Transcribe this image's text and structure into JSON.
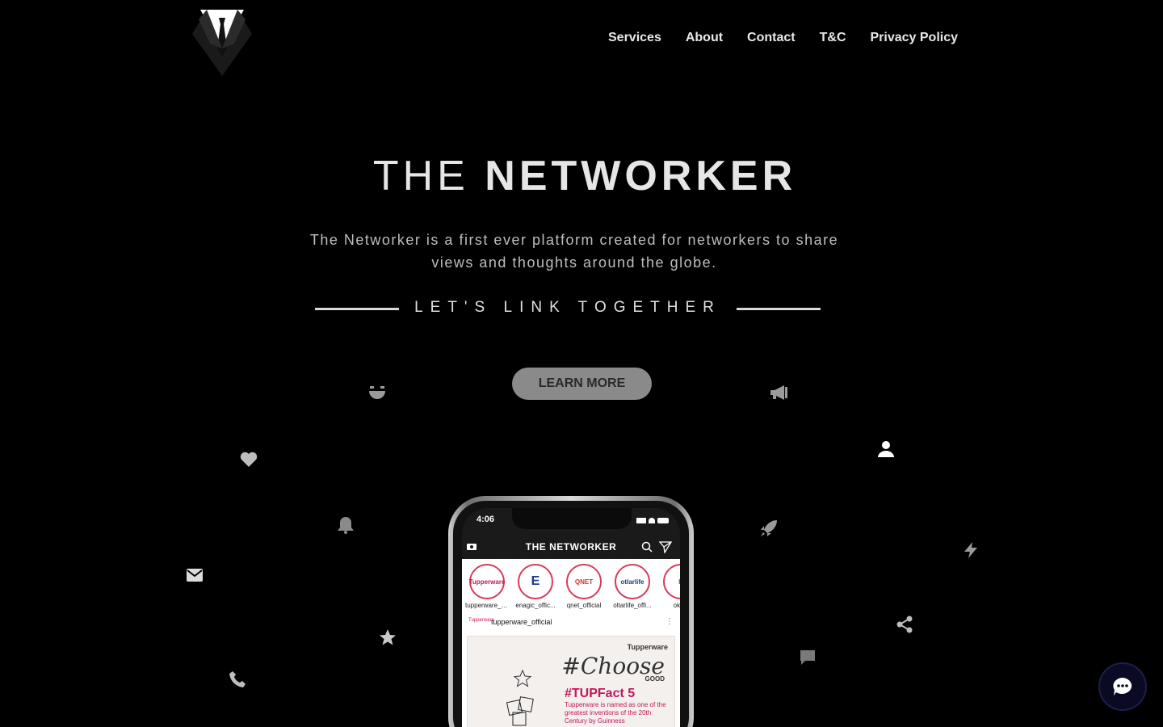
{
  "nav": {
    "items": [
      {
        "label": "Services"
      },
      {
        "label": "About"
      },
      {
        "label": "Contact"
      },
      {
        "label": "T&C"
      },
      {
        "label": "Privacy Policy"
      }
    ]
  },
  "hero": {
    "title_light": "THE ",
    "title_bold": "NETWORKER",
    "description": "The Networker is a first ever platform created for networkers to share views and thoughts around the globe.",
    "tagline": "LET'S LINK TOGETHER",
    "cta_label": "LEARN MORE"
  },
  "phone": {
    "time": "4:06",
    "app_title": "THE NETWORKER",
    "stories": [
      {
        "logo": "Tupperware",
        "name": "tupperware_offi..."
      },
      {
        "logo": "E",
        "name": "enagic_offic..."
      },
      {
        "logo": "QNET",
        "name": "qnet_official"
      },
      {
        "logo": "otlarlife",
        "name": "oltarlife_offi..."
      },
      {
        "logo": "K",
        "name": "oklife"
      }
    ],
    "post": {
      "user": "tupperware_official",
      "avatar_text": "Tupperware",
      "brand": "Tupperware",
      "headline": "#Choose",
      "headline_sub": "GOOD",
      "tag": "#TUPFact 5",
      "fact": "Tupperware is named as one of the greatest inventions of the 20th Century by Guinness"
    }
  },
  "colors": {
    "background": "#000000",
    "nav_text": "#e8e8e8",
    "button_bg": "#8a8a8a",
    "chat_bg": "#0a0a24"
  },
  "icons": {
    "logo": "tuxedo-logo",
    "floating": [
      "grin-icon",
      "megaphone-icon",
      "heart-icon",
      "user-icon",
      "bell-icon",
      "rocket-icon",
      "bolt-icon",
      "mail-icon",
      "star-icon",
      "share-icon",
      "comment-icon",
      "phone-icon"
    ],
    "chat": "chat-dots-icon"
  }
}
